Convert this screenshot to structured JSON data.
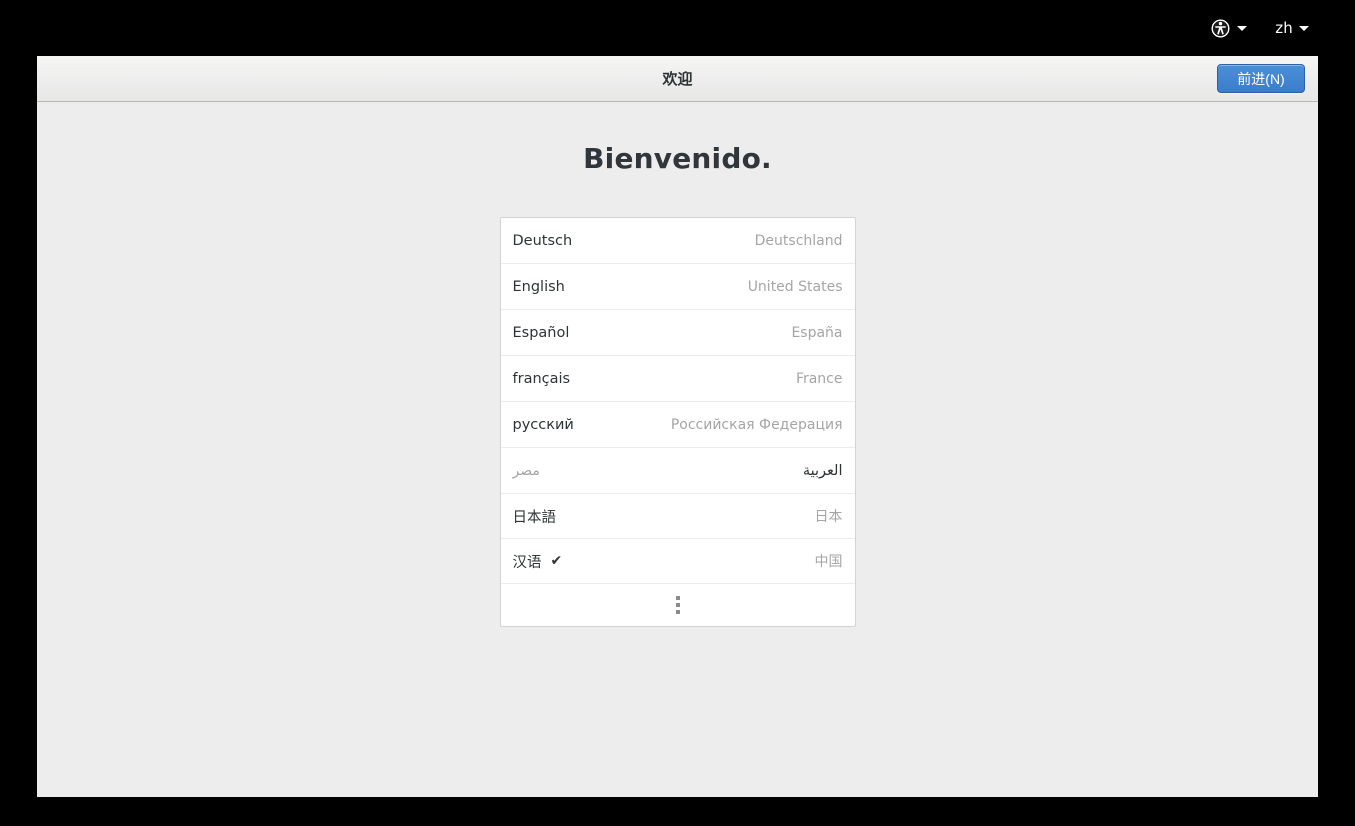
{
  "top_panel": {
    "accessibility_icon": "universal-access-icon",
    "accessibility_arrow": "chevron-down-icon",
    "language_indicator_label": "zh",
    "language_indicator_arrow": "chevron-down-icon"
  },
  "window": {
    "headerbar": {
      "title": "欢迎",
      "next_button_label": "前进(N)"
    },
    "content": {
      "welcome_heading": "Bienvenido.",
      "language_list": {
        "rows": [
          {
            "name": "Deutsch",
            "country": "Deutschland",
            "selected": false,
            "dir": "ltr"
          },
          {
            "name": "English",
            "country": "United States",
            "selected": false,
            "dir": "ltr"
          },
          {
            "name": "Español",
            "country": "España",
            "selected": false,
            "dir": "ltr"
          },
          {
            "name": "français",
            "country": "France",
            "selected": false,
            "dir": "ltr"
          },
          {
            "name": "русский",
            "country": "Российская Федерация",
            "selected": false,
            "dir": "ltr"
          },
          {
            "name": "العربية",
            "country": "مصر",
            "selected": false,
            "dir": "rtl"
          },
          {
            "name": "日本語",
            "country": "日本",
            "selected": false,
            "dir": "ltr"
          },
          {
            "name": "汉语",
            "country": "中国",
            "selected": true,
            "dir": "ltr"
          }
        ],
        "selected_check_glyph": "✔",
        "more_row_icon": "more-vertical-dots-icon"
      }
    }
  },
  "colors": {
    "panel_background": "#000000",
    "window_background": "#ededed",
    "headerbar_background": "#edecec",
    "list_background": "#ffffff",
    "accent_button": "#4a90d9",
    "heading_text": "#31363b",
    "muted_text": "#a5a5a5"
  }
}
